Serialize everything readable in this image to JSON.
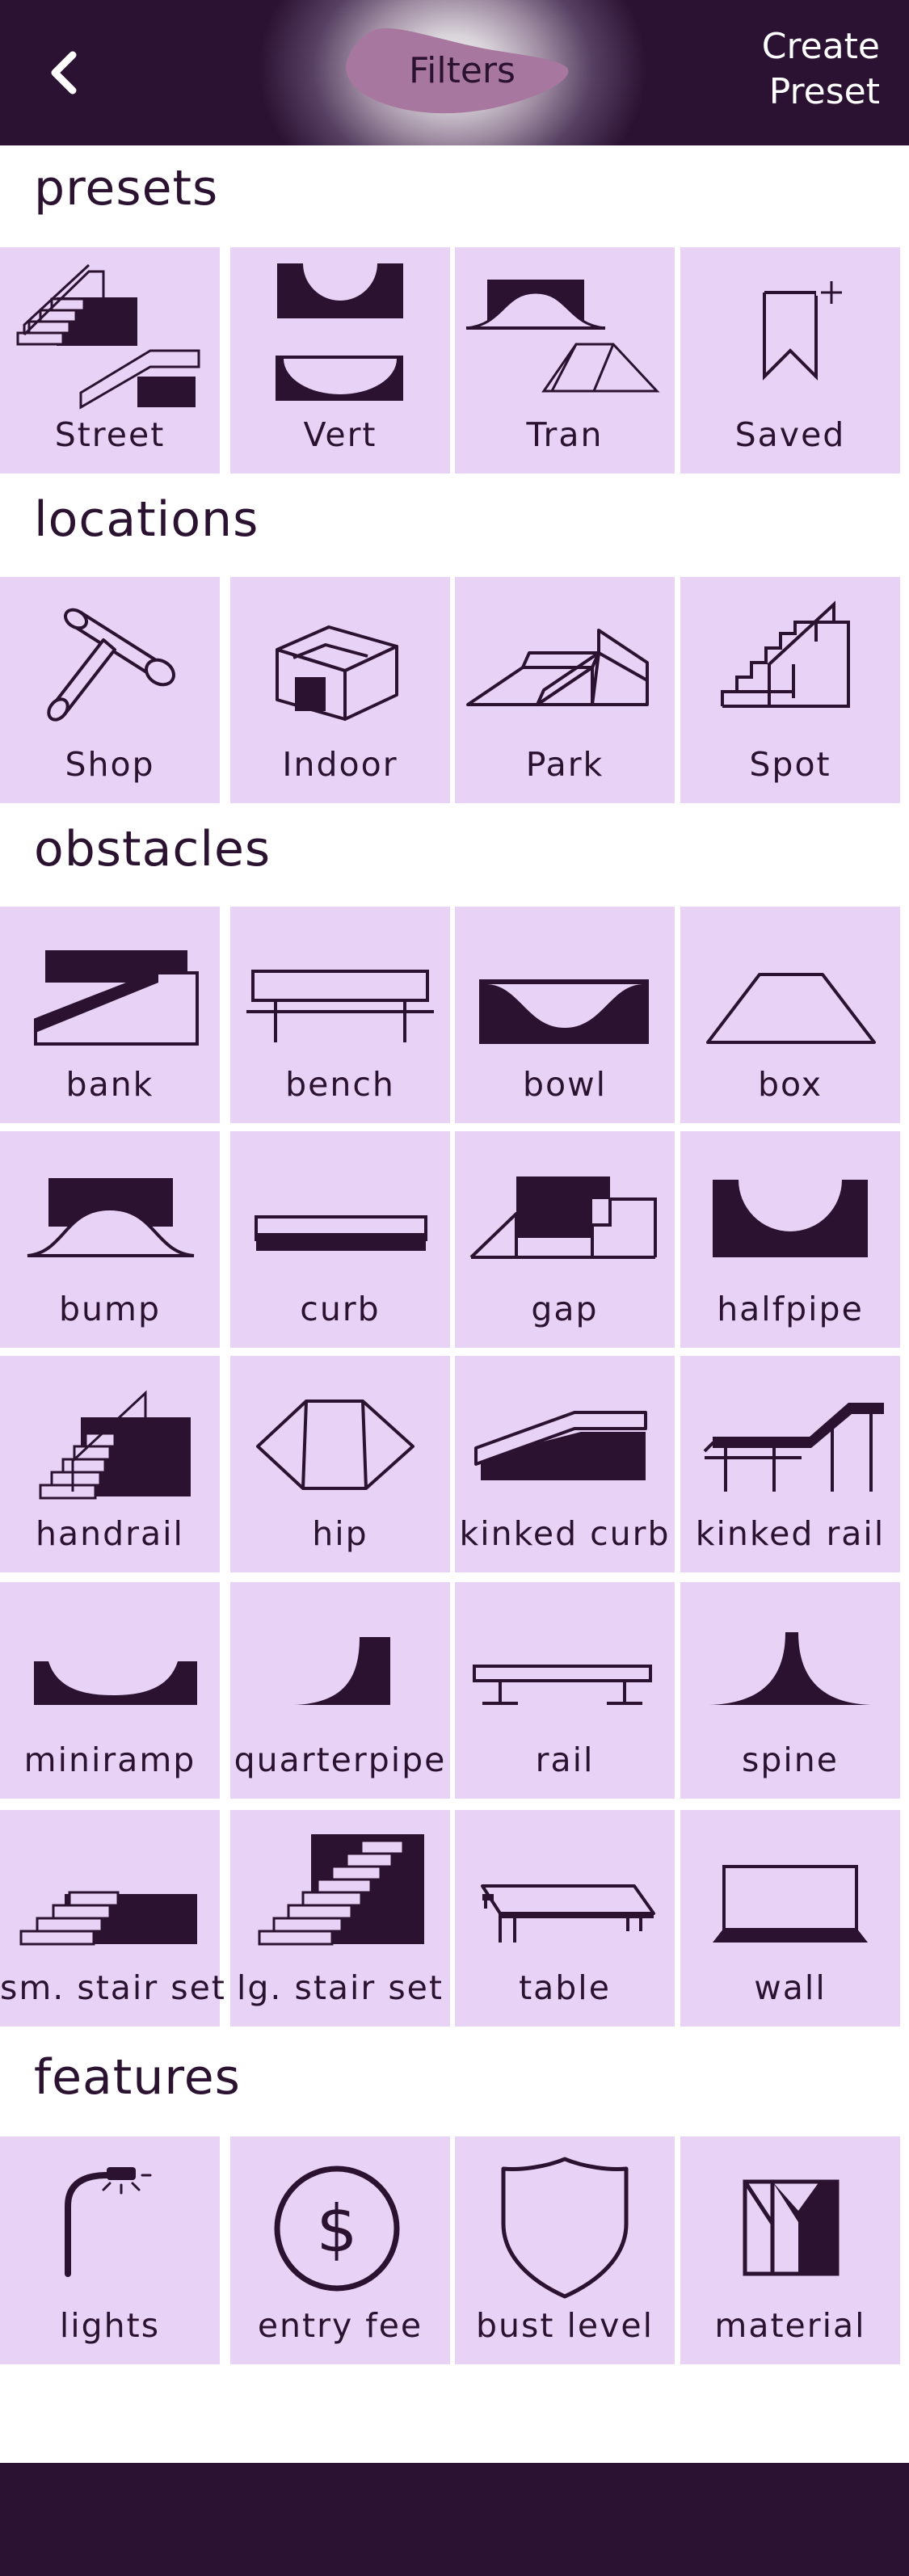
{
  "header": {
    "title": "Filters",
    "create_preset": "Create\nPreset"
  },
  "sections": {
    "presets": {
      "title": "presets",
      "items": [
        {
          "label": "Street",
          "icon": "street-stairs-icon"
        },
        {
          "label": "Vert",
          "icon": "vert-ramp-icon"
        },
        {
          "label": "Tran",
          "icon": "transition-icon"
        },
        {
          "label": "Saved",
          "icon": "bookmark-plus-icon"
        }
      ]
    },
    "locations": {
      "title": "locations",
      "items": [
        {
          "label": "Shop",
          "icon": "skate-tool-icon"
        },
        {
          "label": "Indoor",
          "icon": "building-icon"
        },
        {
          "label": "Park",
          "icon": "skatepark-icon"
        },
        {
          "label": "Spot",
          "icon": "stair-spot-icon"
        }
      ]
    },
    "obstacles": {
      "title": "obstacles",
      "items": [
        {
          "label": "bank",
          "icon": "bank-icon"
        },
        {
          "label": "bench",
          "icon": "bench-icon"
        },
        {
          "label": "bowl",
          "icon": "bowl-icon"
        },
        {
          "label": "box",
          "icon": "box-icon"
        },
        {
          "label": "bump",
          "icon": "bump-icon"
        },
        {
          "label": "curb",
          "icon": "curb-icon"
        },
        {
          "label": "gap",
          "icon": "gap-icon"
        },
        {
          "label": "halfpipe",
          "icon": "halfpipe-icon"
        },
        {
          "label": "handrail",
          "icon": "handrail-icon"
        },
        {
          "label": "hip",
          "icon": "hip-icon"
        },
        {
          "label": "kinked curb",
          "icon": "kinked-curb-icon"
        },
        {
          "label": "kinked rail",
          "icon": "kinked-rail-icon"
        },
        {
          "label": "miniramp",
          "icon": "miniramp-icon"
        },
        {
          "label": "quarterpipe",
          "icon": "quarterpipe-icon"
        },
        {
          "label": "rail",
          "icon": "rail-icon"
        },
        {
          "label": "spine",
          "icon": "spine-icon"
        },
        {
          "label": "sm. stair set",
          "icon": "small-stair-set-icon"
        },
        {
          "label": "lg. stair set",
          "icon": "large-stair-set-icon"
        },
        {
          "label": "table",
          "icon": "table-icon"
        },
        {
          "label": "wall",
          "icon": "wall-icon"
        }
      ]
    },
    "features": {
      "title": "features",
      "items": [
        {
          "label": "lights",
          "icon": "street-light-icon"
        },
        {
          "label": "entry fee",
          "icon": "dollar-icon"
        },
        {
          "label": "bust level",
          "icon": "shield-icon"
        },
        {
          "label": "material",
          "icon": "material-icon"
        }
      ]
    }
  },
  "colors": {
    "header_dark": "#2b1233",
    "tile_background": "#e8d2f5",
    "icon_color": "#2a1230",
    "title_blob": "#a7779f"
  }
}
